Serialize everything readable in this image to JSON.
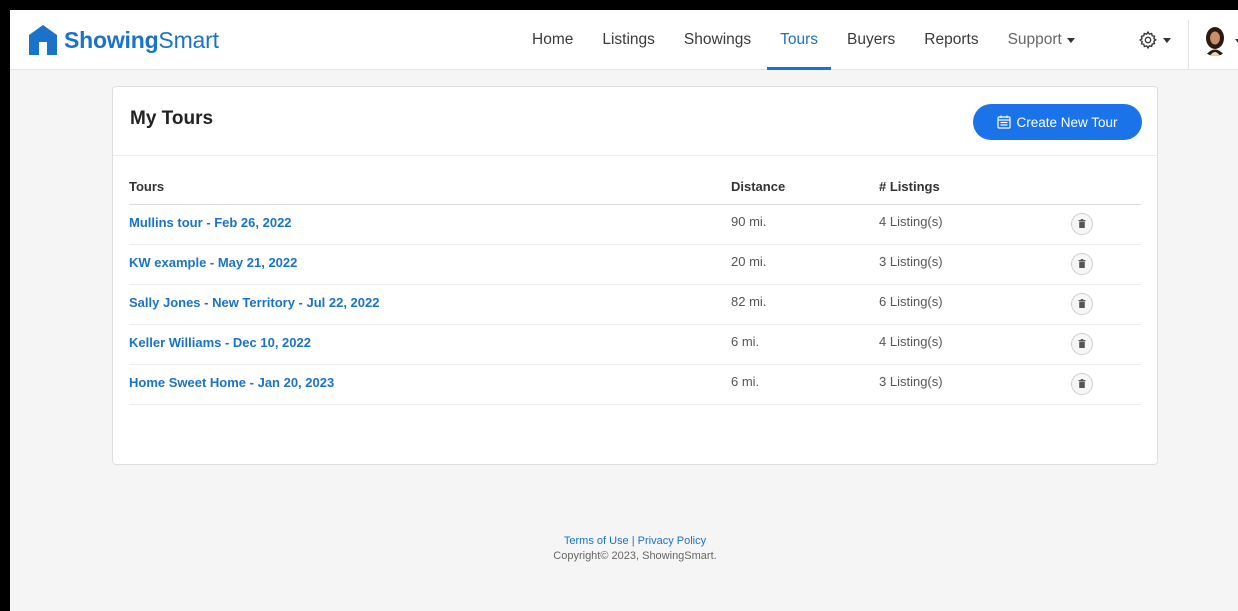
{
  "brand": {
    "name_bold": "Showing",
    "name_light": "Smart"
  },
  "nav": {
    "items": [
      {
        "label": "Home"
      },
      {
        "label": "Listings"
      },
      {
        "label": "Showings"
      },
      {
        "label": "Tours"
      },
      {
        "label": "Buyers"
      },
      {
        "label": "Reports"
      },
      {
        "label": "Support"
      }
    ],
    "active": "Tours",
    "settings_icon": "gear-icon",
    "avatar_icon": "user-avatar"
  },
  "card": {
    "title": "My Tours",
    "create_button": "Create New Tour",
    "columns": {
      "tours": "Tours",
      "distance": "Distance",
      "listings": "# Listings"
    },
    "rows": [
      {
        "name": "Mullins tour - Feb 26, 2022",
        "distance": "90 mi.",
        "listings": "4 Listing(s)"
      },
      {
        "name": "KW example - May 21, 2022",
        "distance": "20 mi.",
        "listings": "3 Listing(s)"
      },
      {
        "name": "Sally Jones - New Territory - Jul 22, 2022",
        "distance": "82 mi.",
        "listings": "6 Listing(s)"
      },
      {
        "name": "Keller Williams - Dec 10, 2022",
        "distance": "6 mi.",
        "listings": "4 Listing(s)"
      },
      {
        "name": "Home Sweet Home - Jan 20, 2023",
        "distance": "6 mi.",
        "listings": "3 Listing(s)"
      }
    ]
  },
  "footer": {
    "terms": "Terms of Use",
    "separator": " | ",
    "privacy": "Privacy Policy",
    "copyright": "Copyright© 2023, ShowingSmart."
  },
  "colors": {
    "accent": "#1a73c8",
    "button": "#1a73e8",
    "background": "#f5f5f5"
  }
}
